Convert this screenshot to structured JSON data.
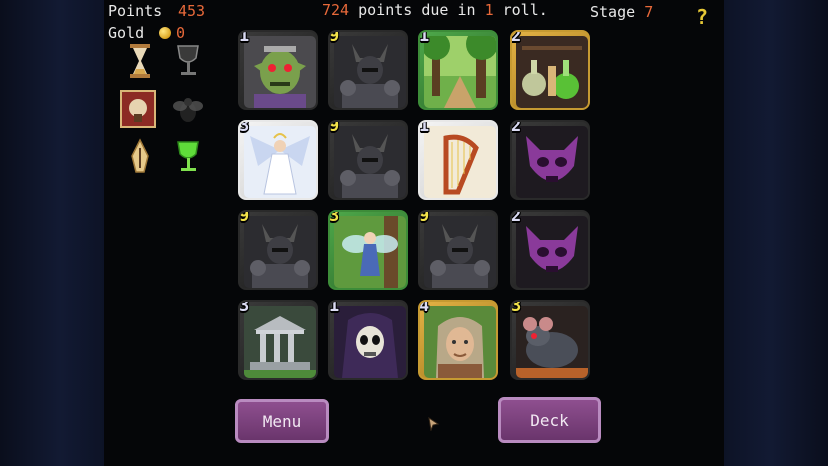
{
  "hud": {
    "points_label": "Points",
    "points_value": "453",
    "gold_label": "Gold",
    "gold_value": "0",
    "due_points": "724",
    "due_mid": " points due in ",
    "due_rolls": "1",
    "due_end": " roll.",
    "stage_label": "Stage",
    "stage_value": "7",
    "help_label": "?"
  },
  "relics": [
    {
      "icon": "hourglass-icon"
    },
    {
      "icon": "dark-goblet-icon"
    },
    {
      "icon": "banner-icon"
    },
    {
      "icon": "fly-icon"
    },
    {
      "icon": "quill-pen-icon"
    },
    {
      "icon": "green-goblet-icon"
    }
  ],
  "cards": [
    {
      "name": "goblin",
      "cost": "1"
    },
    {
      "name": "dark-knight",
      "cost": "9"
    },
    {
      "name": "forest",
      "cost": "1"
    },
    {
      "name": "potions",
      "cost": "2"
    },
    {
      "name": "angel",
      "cost": "3"
    },
    {
      "name": "dark-knight",
      "cost": "9"
    },
    {
      "name": "harp",
      "cost": "1"
    },
    {
      "name": "purple-demon-mask",
      "cost": "2"
    },
    {
      "name": "dark-knight",
      "cost": "9"
    },
    {
      "name": "fairy",
      "cost": "3"
    },
    {
      "name": "dark-knight",
      "cost": "9"
    },
    {
      "name": "purple-demon-mask",
      "cost": "2"
    },
    {
      "name": "temple",
      "cost": "3"
    },
    {
      "name": "skeleton-reaper",
      "cost": "1"
    },
    {
      "name": "old-woman",
      "cost": "4"
    },
    {
      "name": "rat",
      "cost": "3"
    }
  ],
  "buttons": {
    "menu_label": "Menu",
    "deck_label": "Deck"
  },
  "colors": {
    "points": "#e8693a",
    "cost_white": "#dcdcf4",
    "cost_yellow": "#f2e24a",
    "button": "#7a417c"
  }
}
